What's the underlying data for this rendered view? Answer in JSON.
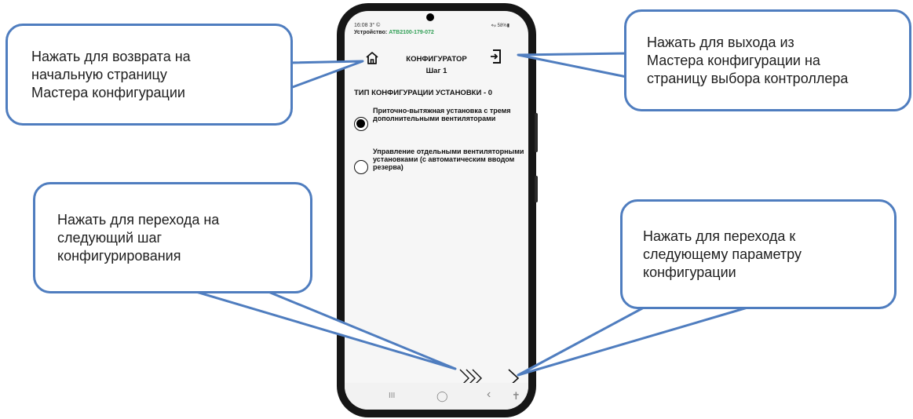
{
  "status_bar": {
    "time": "16:08 3° ©",
    "right": "⋄ᵢₗₗ 58%▮",
    "device_label": "Устройство: ",
    "device_id": "АТВ2100-179-072"
  },
  "header": {
    "title": "КОНФИГУРАТОР",
    "step": "Шаг 1",
    "home_icon": "home-icon",
    "exit_icon": "exit-icon"
  },
  "main": {
    "config_type_label": "ТИП КОНФИГУРАЦИИ УСТАНОВКИ - 0",
    "options": [
      {
        "label": "Приточно-вытяжная установка с тремя дополнительными вентиляторами",
        "selected": true
      },
      {
        "label": "Управление отдельными вентиляторными установками (с автоматическим вводом резерва)",
        "selected": false
      }
    ]
  },
  "footer": {
    "next_step_icon": "double-chevron-right-icon",
    "next_param_icon": "chevron-right-icon"
  },
  "android_nav": {
    "recent": "III",
    "home": "◯",
    "back": "‹",
    "accessibility": "✝"
  },
  "callouts": {
    "home": "Нажать для возврата на\nначальную страницу\nМастера конфигурации",
    "exit": "Нажать для выхода из\nМастера конфигурации на\nстраницу выбора контроллера",
    "next_step": "Нажать для перехода на\nследующий шаг\nконфигурирования",
    "next_param": "Нажать для перехода к\nследующему параметру\nконфигурации"
  },
  "colors": {
    "callout_border": "#4f7dbf",
    "device_id": "#2f9e54"
  }
}
